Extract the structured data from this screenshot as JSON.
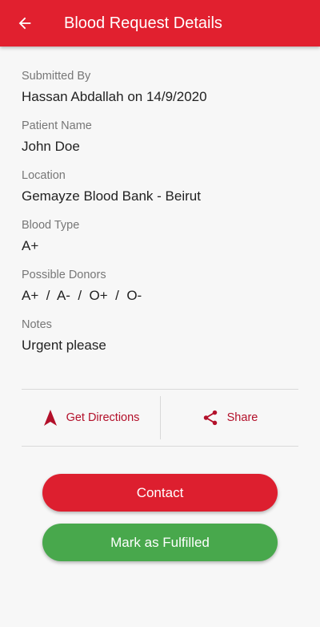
{
  "colors": {
    "app_bar": "#e1202f",
    "accent_text": "#b3102a",
    "contact_button": "#dd1f2f",
    "fulfilled_button": "#48a84c"
  },
  "header": {
    "back_icon": "arrow-left-icon",
    "title": "Blood Request Details"
  },
  "details": {
    "submitted_by": {
      "label": "Submitted By",
      "value": "Hassan Abdallah on 14/9/2020"
    },
    "patient_name": {
      "label": "Patient Name",
      "value": "John Doe"
    },
    "location": {
      "label": "Location",
      "value": "Gemayze Blood Bank - Beirut"
    },
    "blood_type": {
      "label": "Blood Type",
      "value": "A+"
    },
    "possible_donors": {
      "label": "Possible Donors",
      "value": "A+  /  A-  /  O+  /  O-"
    },
    "notes": {
      "label": "Notes",
      "value": "Urgent please"
    }
  },
  "actions": {
    "directions": {
      "icon": "navigation-arrow-icon",
      "label": "Get Directions"
    },
    "share": {
      "icon": "share-icon",
      "label": "Share"
    }
  },
  "buttons": {
    "contact": "Contact",
    "mark_fulfilled": "Mark as Fulfilled"
  }
}
